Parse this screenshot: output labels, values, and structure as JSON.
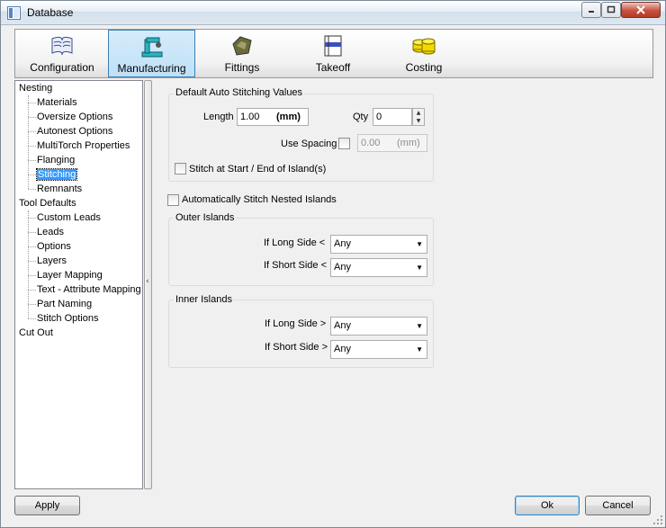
{
  "window": {
    "title": "Database"
  },
  "toolbar": {
    "items": [
      {
        "label": "Configuration",
        "icon": "book-icon"
      },
      {
        "label": "Manufacturing",
        "icon": "robot-arm-icon",
        "active": true
      },
      {
        "label": "Fittings",
        "icon": "fitting-icon"
      },
      {
        "label": "Takeoff",
        "icon": "takeoff-icon"
      },
      {
        "label": "Costing",
        "icon": "coins-icon"
      }
    ]
  },
  "tree": {
    "items": [
      {
        "label": "Nesting",
        "level": 0
      },
      {
        "label": "Materials",
        "level": 1
      },
      {
        "label": "Oversize Options",
        "level": 1
      },
      {
        "label": "Autonest Options",
        "level": 1
      },
      {
        "label": "MultiTorch Properties",
        "level": 1
      },
      {
        "label": "Flanging",
        "level": 1
      },
      {
        "label": "Stitching",
        "level": 1,
        "selected": true
      },
      {
        "label": "Remnants",
        "level": 1
      },
      {
        "label": "Tool Defaults",
        "level": 0
      },
      {
        "label": "Custom Leads",
        "level": 1
      },
      {
        "label": "Leads",
        "level": 1
      },
      {
        "label": "Options",
        "level": 1
      },
      {
        "label": "Layers",
        "level": 1
      },
      {
        "label": "Layer Mapping",
        "level": 1
      },
      {
        "label": "Text - Attribute Mapping",
        "level": 1
      },
      {
        "label": "Part Naming",
        "level": 1
      },
      {
        "label": "Stitch Options",
        "level": 1
      },
      {
        "label": "Cut Out",
        "level": 0
      }
    ]
  },
  "stitching": {
    "group_title": "Default Auto Stitching Values",
    "length_label": "Length",
    "length_value": "1.00",
    "length_unit": "(mm)",
    "qty_label": "Qty",
    "qty_value": "0",
    "use_spacing_label": "Use Spacing",
    "spacing_value": "0.00",
    "spacing_unit": "(mm)",
    "stitch_start_end_label": "Stitch at Start / End of Island(s)",
    "auto_stitch_nested_label": "Automatically Stitch Nested Islands"
  },
  "outer_islands": {
    "title": "Outer Islands",
    "long_side_label": "If Long Side <",
    "long_side_value": "Any",
    "short_side_label": "If Short Side <",
    "short_side_value": "Any"
  },
  "inner_islands": {
    "title": "Inner Islands",
    "long_side_label": "If Long Side >",
    "long_side_value": "Any",
    "short_side_label": "If Short Side >",
    "short_side_value": "Any"
  },
  "buttons": {
    "apply": "Apply",
    "ok": "Ok",
    "cancel": "Cancel"
  },
  "splitter": {
    "arrow": "‹"
  }
}
